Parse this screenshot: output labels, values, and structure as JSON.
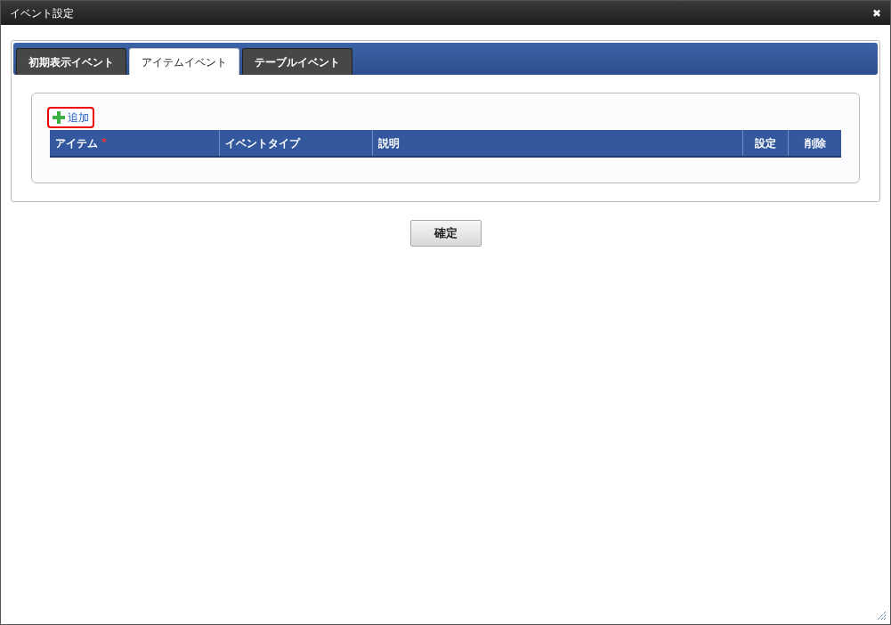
{
  "window": {
    "title": "イベント設定",
    "close_icon": "✖"
  },
  "tabs": [
    {
      "label": "初期表示イベント",
      "selected": false
    },
    {
      "label": "アイテムイベント",
      "selected": true
    },
    {
      "label": "テーブルイベント",
      "selected": false
    }
  ],
  "add_link": {
    "label": "追加",
    "highlighted": true
  },
  "table": {
    "required_mark": "*",
    "columns": [
      {
        "label": "アイテム",
        "required": true
      },
      {
        "label": "イベントタイプ",
        "required": false
      },
      {
        "label": "説明",
        "required": false
      },
      {
        "label": "設定",
        "required": false
      },
      {
        "label": "削除",
        "required": false
      }
    ]
  },
  "buttons": [
    "確定"
  ]
}
